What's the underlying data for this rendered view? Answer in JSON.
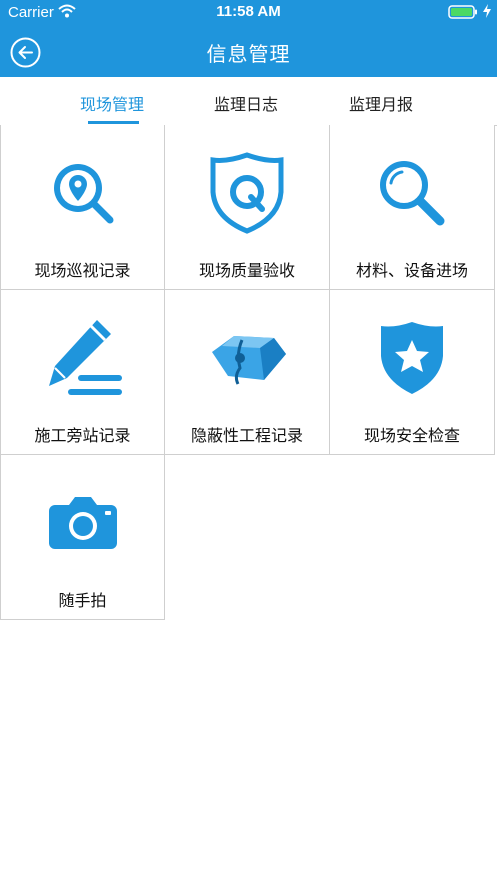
{
  "status_bar": {
    "carrier": "Carrier",
    "time": "11:58 AM"
  },
  "header": {
    "title": "信息管理",
    "accent_color": "#1f95dc"
  },
  "tabs": [
    {
      "label": "现场管理",
      "active": true
    },
    {
      "label": "监理日志",
      "active": false
    },
    {
      "label": "监理月报",
      "active": false
    }
  ],
  "grid_items": [
    {
      "label": "现场巡视记录",
      "icon": "location-search-icon"
    },
    {
      "label": "现场质量验收",
      "icon": "shield-q-icon"
    },
    {
      "label": "材料、设备进场",
      "icon": "magnifier-icon"
    },
    {
      "label": "施工旁站记录",
      "icon": "pencil-icon"
    },
    {
      "label": "隐蔽性工程记录",
      "icon": "cube-icon"
    },
    {
      "label": "现场安全检查",
      "icon": "shield-star-icon"
    },
    {
      "label": "随手拍",
      "icon": "camera-icon"
    }
  ]
}
